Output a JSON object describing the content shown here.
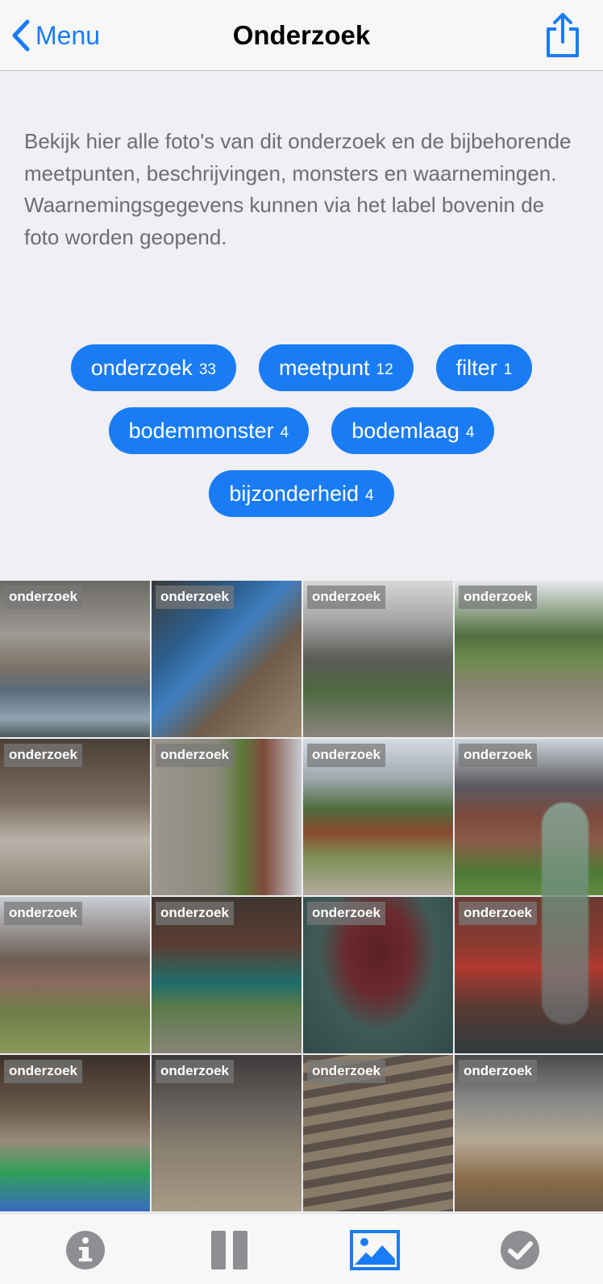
{
  "nav": {
    "back_label": "Menu",
    "title": "Onderzoek",
    "back_icon": "chevron-left-icon",
    "share_icon": "share-icon"
  },
  "description": "Bekijk hier alle foto's van dit onderzoek en de bijbehorende meetpunten, beschrijvingen, monsters en waarnemingen. Waarnemingsgegevens kunnen via het label bovenin de foto worden geopend.",
  "filters": [
    {
      "label": "onderzoek",
      "count": "33"
    },
    {
      "label": "meetpunt",
      "count": "12"
    },
    {
      "label": "filter",
      "count": "1"
    },
    {
      "label": "bodemmonster",
      "count": "4"
    },
    {
      "label": "bodemlaag",
      "count": "4"
    },
    {
      "label": "bijzonderheid",
      "count": "4"
    }
  ],
  "photos": [
    {
      "tag": "onderzoek"
    },
    {
      "tag": "onderzoek"
    },
    {
      "tag": "onderzoek"
    },
    {
      "tag": "onderzoek"
    },
    {
      "tag": "onderzoek"
    },
    {
      "tag": "onderzoek"
    },
    {
      "tag": "onderzoek"
    },
    {
      "tag": "onderzoek"
    },
    {
      "tag": "onderzoek"
    },
    {
      "tag": "onderzoek"
    },
    {
      "tag": "onderzoek"
    },
    {
      "tag": "onderzoek"
    },
    {
      "tag": "onderzoek"
    },
    {
      "tag": "onderzoek"
    },
    {
      "tag": "onderzoek"
    },
    {
      "tag": "onderzoek"
    }
  ],
  "tabs": [
    {
      "icon": "info-icon",
      "active": false
    },
    {
      "icon": "columns-icon",
      "active": false
    },
    {
      "icon": "photo-icon",
      "active": true
    },
    {
      "icon": "checkmark-circle-icon",
      "active": false
    }
  ],
  "colors": {
    "accent": "#1a7cf5",
    "tab_inactive": "#8e8e93",
    "background": "#efeff4"
  }
}
